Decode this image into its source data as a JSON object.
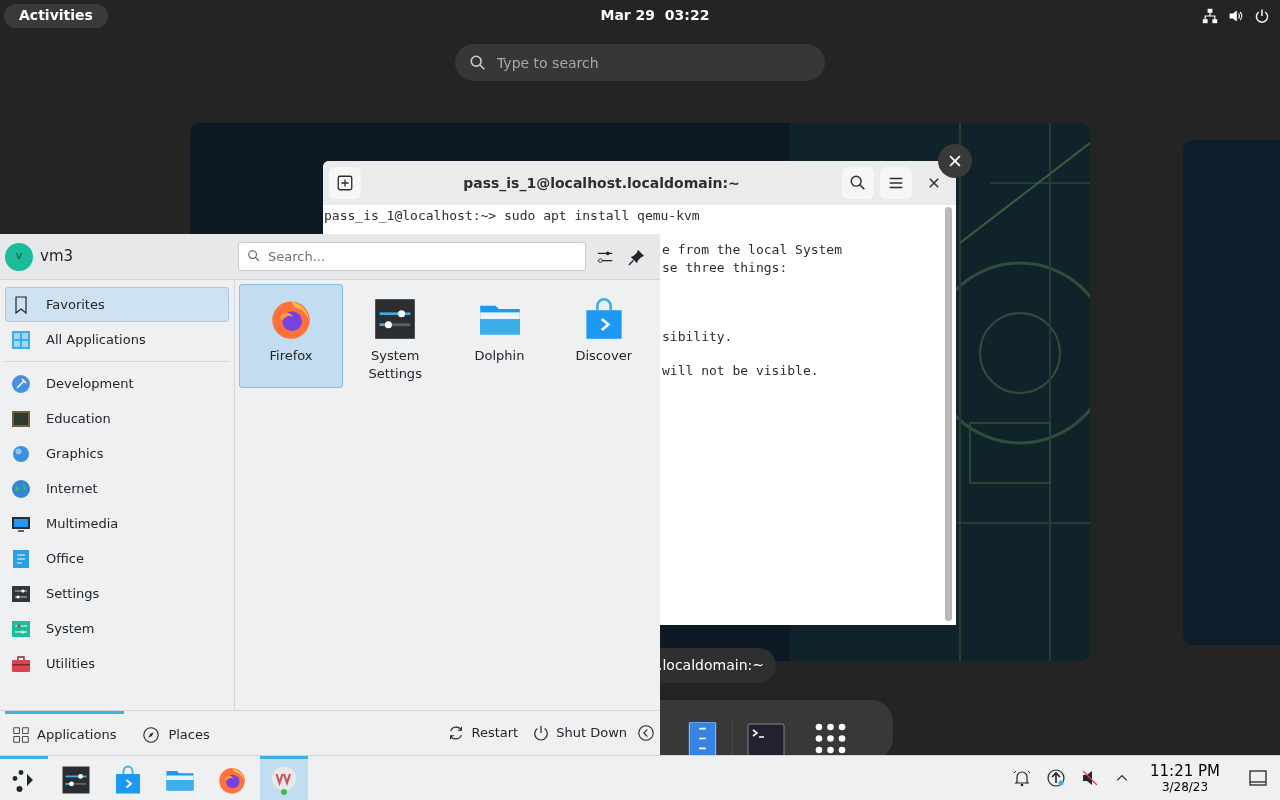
{
  "top_bar": {
    "activities": "Activities",
    "clock": "Mar 29  03:22"
  },
  "overview_search": {
    "placeholder": "Type to search"
  },
  "terminal": {
    "title": "pass_is_1@localhost.localdomain:~",
    "command_line": "pass_is_1@localhost:~> sudo apt install qemu-kvm",
    "blocks": [
      [
        "e from the local System",
        "se three things:"
      ],
      [
        "sibility."
      ],
      [
        "will not be visible."
      ]
    ],
    "caption": ".localdomain:~"
  },
  "menu": {
    "user": {
      "initial": "v",
      "name": "vm3"
    },
    "search": {
      "placeholder": "Search..."
    },
    "categories": [
      {
        "label": "Favorites",
        "selected": true
      },
      {
        "label": "All Applications",
        "selected": false
      },
      {
        "label": "Development",
        "selected": false
      },
      {
        "label": "Education",
        "selected": false
      },
      {
        "label": "Graphics",
        "selected": false
      },
      {
        "label": "Internet",
        "selected": false
      },
      {
        "label": "Multimedia",
        "selected": false
      },
      {
        "label": "Office",
        "selected": false
      },
      {
        "label": "Settings",
        "selected": false
      },
      {
        "label": "System",
        "selected": false
      },
      {
        "label": "Utilities",
        "selected": false
      }
    ],
    "apps": [
      {
        "kind": "firefox",
        "label": "Firefox",
        "selected": true
      },
      {
        "kind": "settings",
        "label": "System Settings",
        "selected": false
      },
      {
        "kind": "dolphin",
        "label": "Dolphin",
        "selected": false
      },
      {
        "kind": "discover",
        "label": "Discover",
        "selected": false
      }
    ],
    "tabs": [
      {
        "label": "Applications",
        "selected": true
      },
      {
        "label": "Places",
        "selected": false
      }
    ],
    "actions": [
      {
        "kind": "restart",
        "label": "Restart"
      },
      {
        "kind": "shutdown",
        "label": "Shut Down"
      }
    ]
  },
  "taskbar": {
    "tasks": [
      {
        "kind": "launcher",
        "active": true,
        "selected": false
      },
      {
        "kind": "settings",
        "active": false,
        "selected": false
      },
      {
        "kind": "discover",
        "active": false,
        "selected": false
      },
      {
        "kind": "dolphin",
        "active": false,
        "selected": false
      },
      {
        "kind": "firefox",
        "active": false,
        "selected": false
      },
      {
        "kind": "virt",
        "active": true,
        "selected": true
      }
    ],
    "clock": {
      "time": "11:21 PM",
      "date": "3/28/23"
    }
  }
}
